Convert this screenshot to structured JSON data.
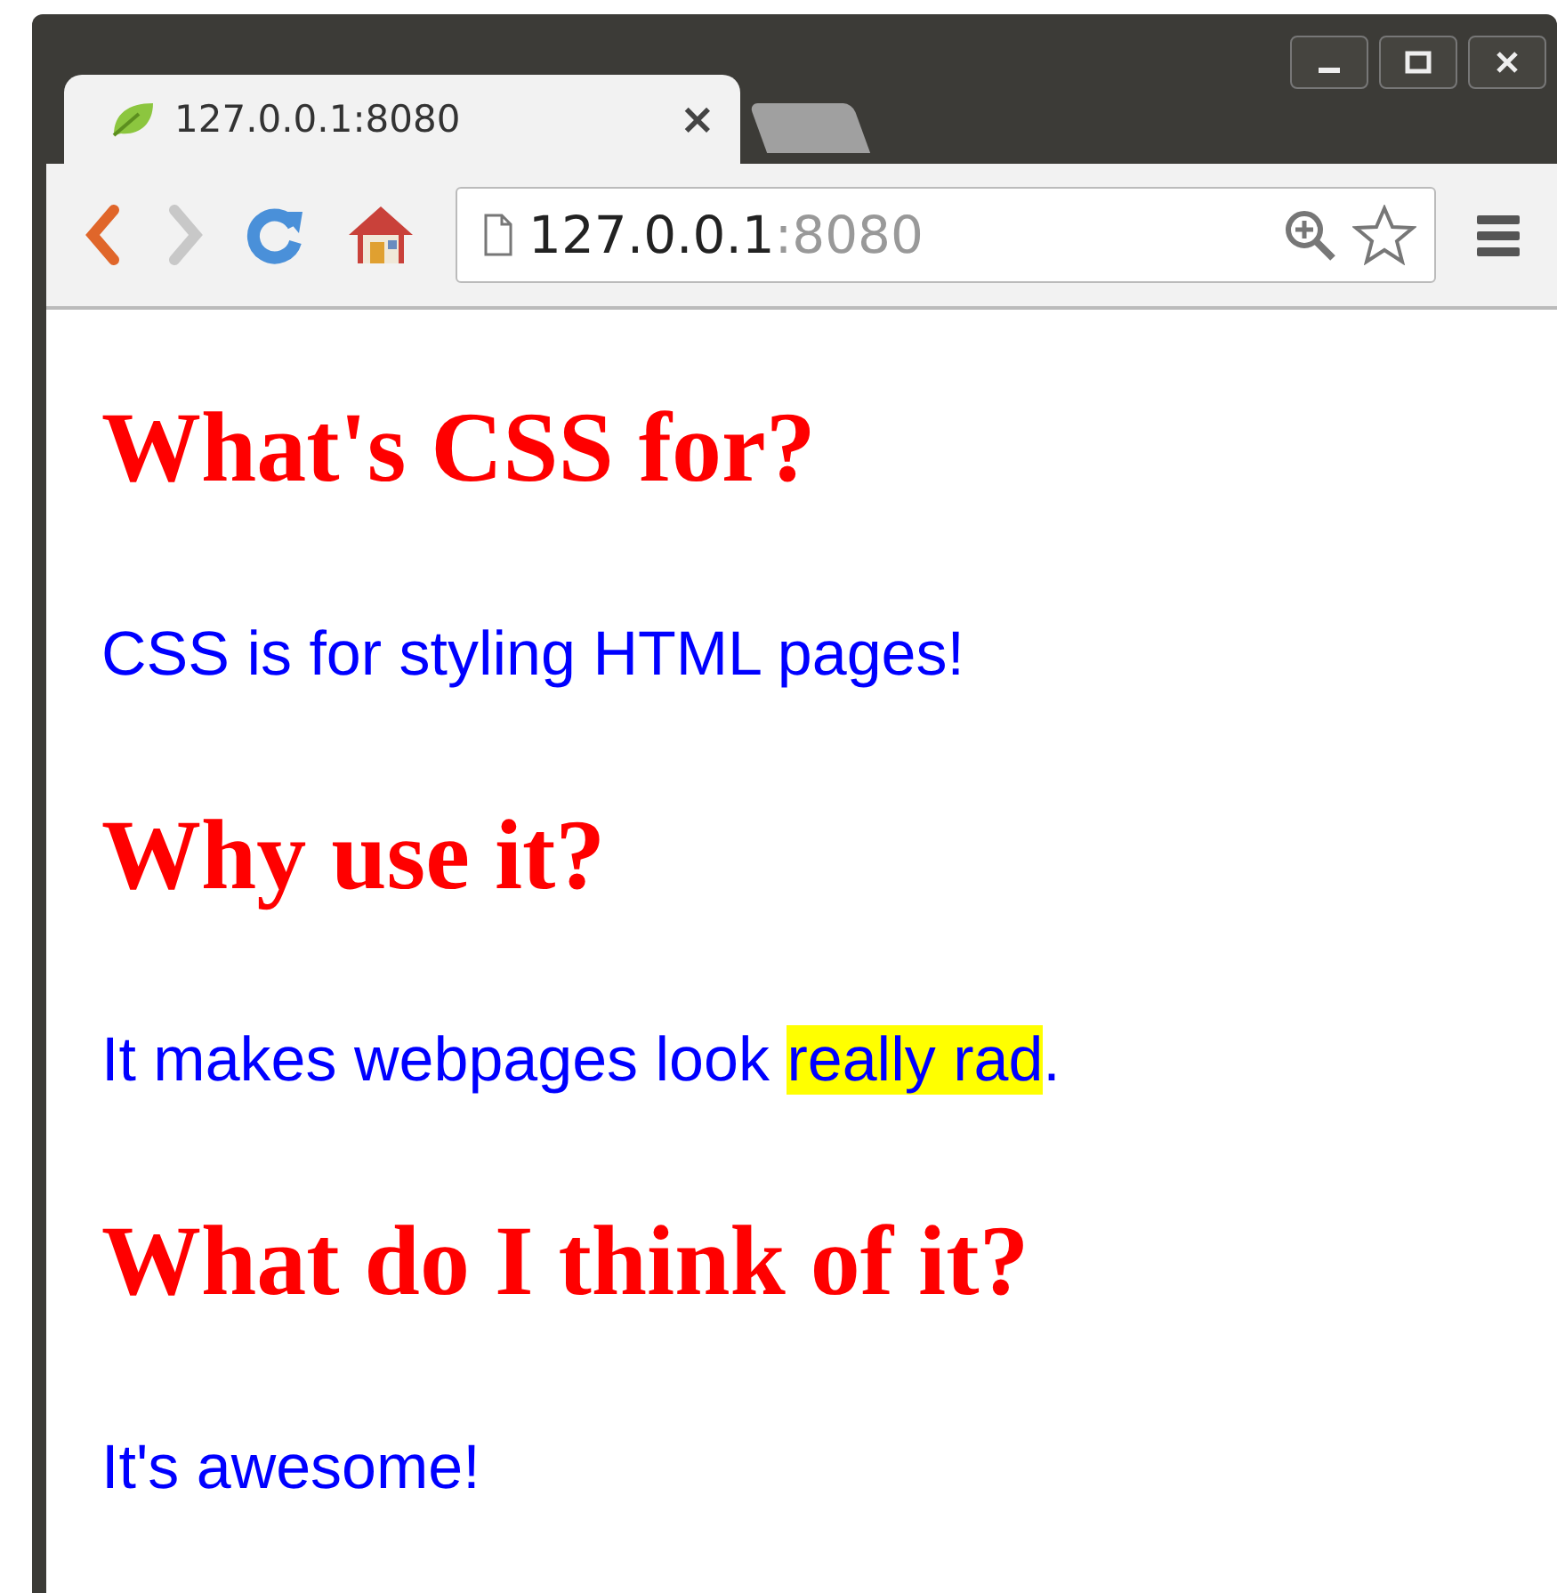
{
  "tabs": [
    {
      "title": "127.0.0.1:8080",
      "close": "×",
      "selected": true
    },
    {
      "selected": false
    }
  ],
  "address_bar": {
    "host": "127.0.0.1",
    "port": ":8080"
  },
  "content": [
    {
      "kind": "heading",
      "segments": [
        {
          "text": "What's CSS for?",
          "highlight": false
        }
      ]
    },
    {
      "kind": "paragraph",
      "segments": [
        {
          "text": "CSS is for styling HTML pages!",
          "highlight": false
        }
      ]
    },
    {
      "kind": "heading",
      "segments": [
        {
          "text": "Why use it?",
          "highlight": false
        }
      ]
    },
    {
      "kind": "paragraph",
      "segments": [
        {
          "text": "It makes webpages look ",
          "highlight": false
        },
        {
          "text": "really rad",
          "highlight": true
        },
        {
          "text": ".",
          "highlight": false
        }
      ]
    },
    {
      "kind": "heading",
      "segments": [
        {
          "text": "What do I think of it?",
          "highlight": false
        }
      ]
    },
    {
      "kind": "paragraph",
      "segments": [
        {
          "text": "It's awesome!",
          "highlight": false
        }
      ]
    }
  ]
}
